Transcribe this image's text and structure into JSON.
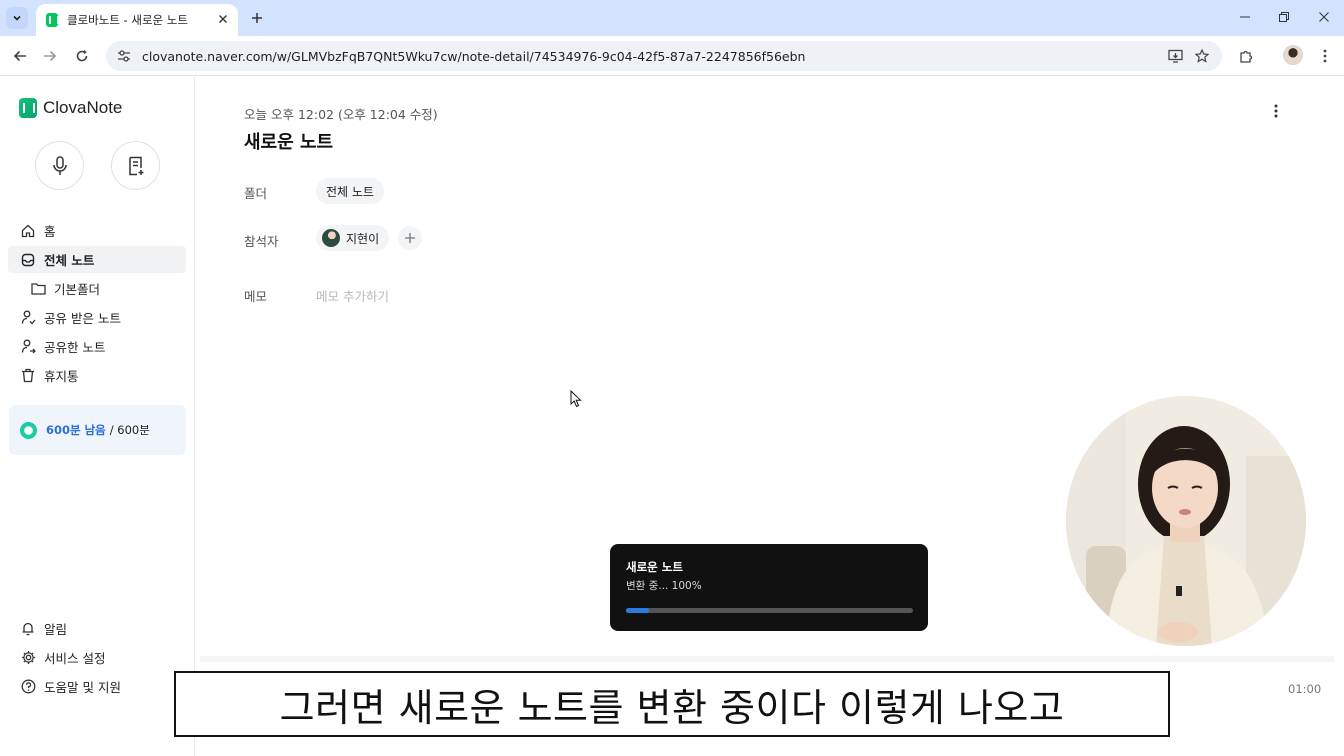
{
  "browser": {
    "tab_title": "클로바노트 - 새로운 노트",
    "url": "clovanote.naver.com/w/GLMVbzFqB7QNt5Wku7cw/note-detail/74534976-9c04-42f5-87a7-2247856f56ebn",
    "icons": {
      "tab_menu": "chevron-down-icon",
      "close_tab": "close-icon",
      "new_tab": "plus-icon",
      "back": "arrow-left-icon",
      "forward": "arrow-right-icon",
      "reload": "reload-icon",
      "site_info": "tune-icon",
      "install": "install-app-icon",
      "bookmark": "star-icon",
      "extensions": "puzzle-icon",
      "menu": "kebab-icon"
    },
    "accent_color": "#d3e3fd"
  },
  "sidebar": {
    "brand": "ClovaNote",
    "brand_color": "#07a36a",
    "items": [
      {
        "label": "홈",
        "icon": "home-icon"
      },
      {
        "label": "전체 노트",
        "icon": "inbox-icon",
        "active": true
      },
      {
        "label": "기본폴더",
        "icon": "folder-icon"
      },
      {
        "label": "공유 받은 노트",
        "icon": "user-shared-icon"
      },
      {
        "label": "공유한 노트",
        "icon": "user-share-icon"
      },
      {
        "label": "휴지통",
        "icon": "trash-icon"
      }
    ],
    "usage": {
      "remaining": "600분 남음",
      "total": "/ 600분"
    },
    "bottom_items": [
      {
        "label": "알림",
        "icon": "bell-icon"
      },
      {
        "label": "서비스 설정",
        "icon": "gear-icon"
      },
      {
        "label": "도움말 및 지원",
        "icon": "help-icon"
      }
    ]
  },
  "note": {
    "timestamp": "오늘 오후 12:02 (오후 12:04 수정)",
    "title": "새로운 노트",
    "folder_label": "폴더",
    "folder_value": "전체 노트",
    "participants_label": "참석자",
    "participant": "지현이",
    "memo_label": "메모",
    "memo_placeholder": "메모 추가하기",
    "playtime": "01:00"
  },
  "toast": {
    "title": "새로운 노트",
    "status": "변환 중... 100%",
    "progress": 0.08
  },
  "subtitle": "그러면 새로운 노트를 변환 중이다 이렇게 나오고"
}
